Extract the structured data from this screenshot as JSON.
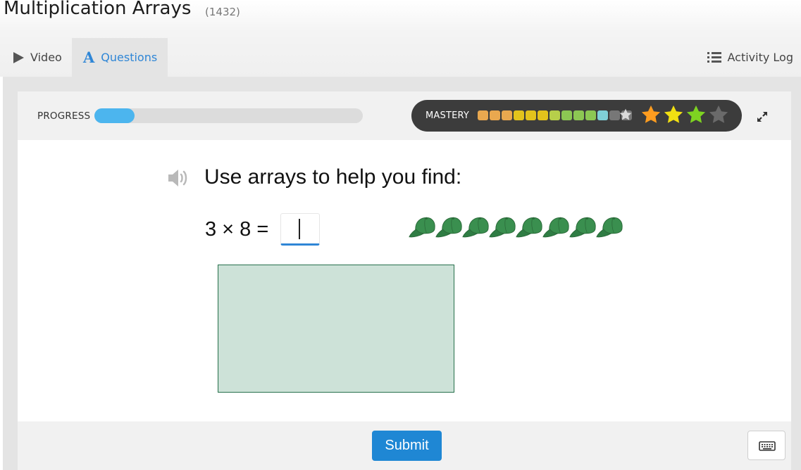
{
  "header": {
    "title": "Multiplication Arrays",
    "code": "(1432)"
  },
  "tabs": [
    {
      "label": "Video",
      "icon": "play-icon",
      "active": false
    },
    {
      "label": "Questions",
      "icon": "a-icon",
      "active": true
    }
  ],
  "activity_log": {
    "label": "Activity Log",
    "icon": "list-icon"
  },
  "progress": {
    "label": "PROGRESS",
    "value": 0.15,
    "color": "#4cb5ee"
  },
  "mastery": {
    "label": "MASTERY",
    "segment_colors": [
      "#e9a84f",
      "#e9a84f",
      "#e9a84f",
      "#e3c31c",
      "#e3c31c",
      "#e3c31c",
      "#b7cf4a",
      "#8cc753",
      "#8cc753",
      "#8cc753",
      "#7fcfd7",
      "#777777",
      "#777777"
    ],
    "stars": [
      "#ff9d1f",
      "#f2e012",
      "#7ed321",
      "#6a6a6a"
    ]
  },
  "question": {
    "prompt": "Use arrays to help you find:",
    "equation": "3 × 8 =",
    "answer_value": "",
    "cap_count": 8,
    "cap_color": "#3a8f4f"
  },
  "submit_label": "Submit"
}
